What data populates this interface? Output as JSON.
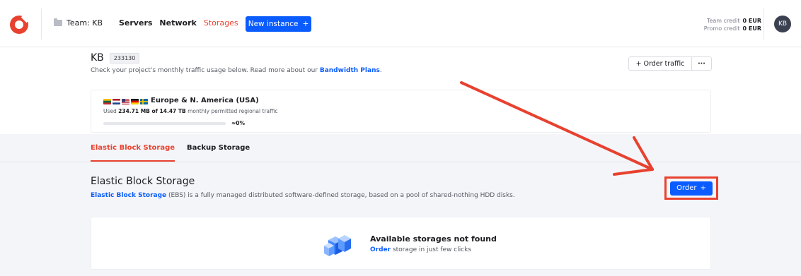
{
  "topbar": {
    "team_label": "Team: KB",
    "nav": [
      {
        "label": "Servers",
        "active": false
      },
      {
        "label": "Network",
        "active": false
      },
      {
        "label": "Storages",
        "active": true
      }
    ],
    "new_instance_label": "New instance",
    "team_credit_label": "Team credit",
    "team_credit_value": "0 EUR",
    "promo_credit_label": "Promo credit",
    "promo_credit_value": "0 EUR",
    "avatar_initials": "KB"
  },
  "project": {
    "name": "KB",
    "id": "233130",
    "desc_prefix": "Check your project's monthly traffic usage below. Read more about our ",
    "desc_link": "Bandwidth Plans",
    "desc_suffix": ".",
    "order_traffic_label": "Order traffic",
    "more_label": "···"
  },
  "region": {
    "name": "Europe & N. America (USA)",
    "used_prefix": "Used ",
    "used_value": "234.71 MB of 14.47 TB",
    "used_suffix": " monthly permitted regional traffic",
    "percent_text": "≈0%",
    "percent": 0,
    "flags": [
      "lithuania",
      "netherlands",
      "usa",
      "germany",
      "sweden"
    ]
  },
  "tabs": [
    {
      "label": "Elastic Block Storage",
      "active": true
    },
    {
      "label": "Backup Storage",
      "active": false
    }
  ],
  "section": {
    "title": "Elastic Block Storage",
    "desc_link": "Elastic Block Storage",
    "desc_rest": " (EBS) is a fully managed distributed software-defined storage, based on a pool of shared-nothing HDD disks.",
    "order_label": "Order"
  },
  "empty": {
    "title": "Available storages not found",
    "link": "Order",
    "rest": " storage in just few clicks"
  },
  "colors": {
    "accent": "#e8412f",
    "primary": "#0b5cff"
  }
}
